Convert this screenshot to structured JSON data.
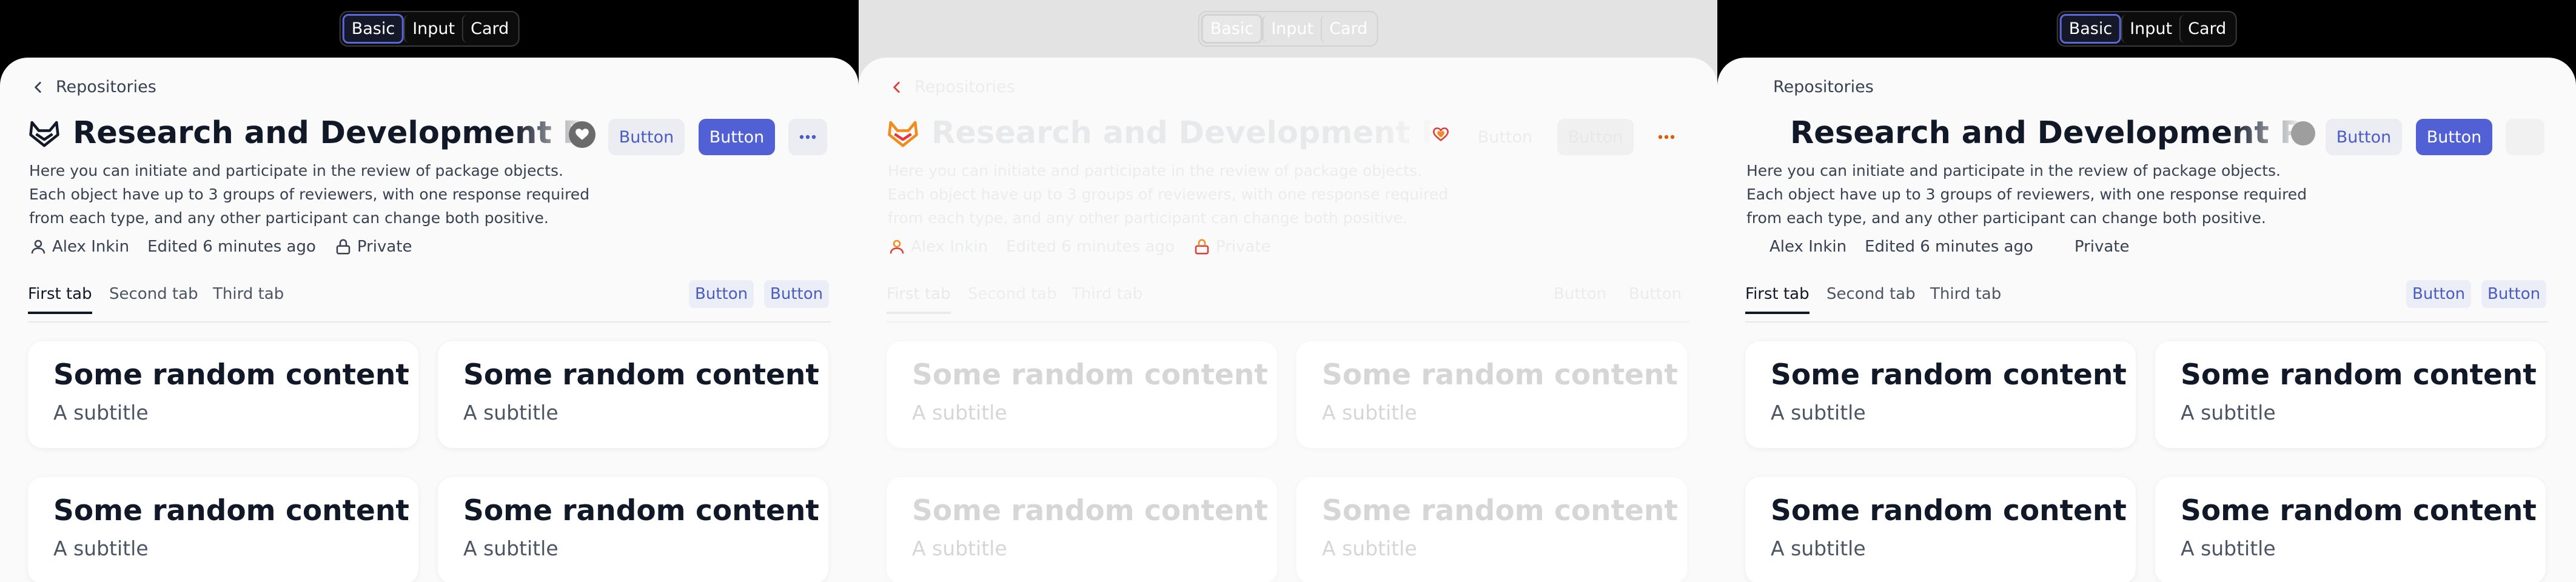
{
  "segmented": {
    "options": [
      "Basic",
      "Input",
      "Card"
    ],
    "active": "Basic"
  },
  "breadcrumb": {
    "label": "Repositories"
  },
  "header": {
    "title": "Research and Development Platform",
    "description": "Here you can initiate and participate in the review of package objects. Each object have up to 3 groups of reviewers, with one response required from each type, and any other participant can change both positive.",
    "secondary_button": "Button",
    "primary_button": "Button",
    "more_button": "···"
  },
  "meta": {
    "author": "Alex Inkin",
    "edited": "Edited 6 minutes ago",
    "visibility": "Private"
  },
  "tabs": {
    "items": [
      "First tab",
      "Second tab",
      "Third tab"
    ],
    "buttons": [
      "Button",
      "Button"
    ]
  },
  "cards": [
    {
      "title": "Some random content",
      "subtitle": "A subtitle"
    },
    {
      "title": "Some random content",
      "subtitle": "A subtitle"
    },
    {
      "title": "Some random content",
      "subtitle": "A subtitle"
    },
    {
      "title": "Some random content",
      "subtitle": "A subtitle"
    }
  ],
  "colors": {
    "accent": "#5161d5",
    "accent_light": "#ececf3",
    "orange": "#f28a1c",
    "red": "#e53935"
  }
}
